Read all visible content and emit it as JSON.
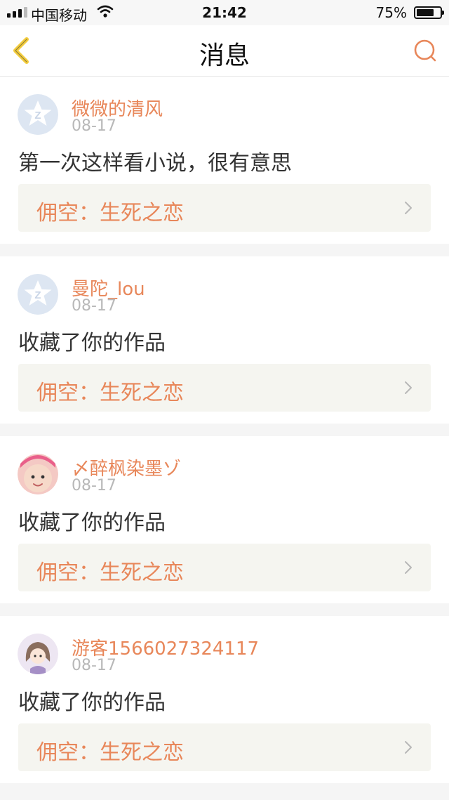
{
  "status_bar": {
    "carrier": "中国移动",
    "time": "21:42",
    "battery": "75%",
    "battery_level": 0.75
  },
  "nav": {
    "title": "消息",
    "back_icon": "chevron-left-icon",
    "search_icon": "search-icon"
  },
  "colors": {
    "accent": "#e8875a",
    "back_icon": "#f3cc3c",
    "date": "#b8b8b8",
    "text": "#333333",
    "link_bg": "#f5f5f0"
  },
  "messages": [
    {
      "username": "微微的清风",
      "date": "08-17",
      "text": "第一次这样看小说，很有意思",
      "work": "佣空：生死之恋",
      "avatar": "qq-default-avatar"
    },
    {
      "username": "曼陀_lou",
      "date": "08-17",
      "text": "收藏了你的作品",
      "work": "佣空：生死之恋",
      "avatar": "qq-default-avatar"
    },
    {
      "username": "〆醉枫染墨ゾ",
      "date": "08-17",
      "text": "收藏了你的作品",
      "work": "佣空：生死之恋",
      "avatar": "baby-photo-avatar"
    },
    {
      "username": "游客1566027324117",
      "date": "08-17",
      "text": "收藏了你的作品",
      "work": "佣空：生死之恋",
      "avatar": "cartoon-girl-avatar"
    }
  ]
}
